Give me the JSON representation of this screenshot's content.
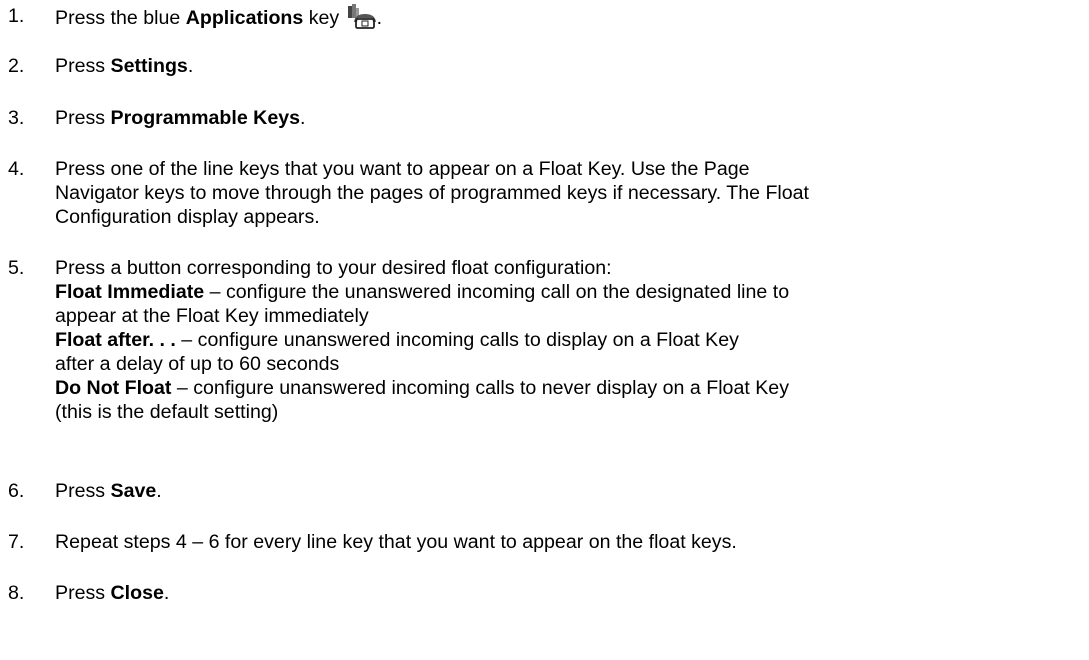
{
  "steps": [
    {
      "num": "1.",
      "parts": [
        {
          "t": "Press the blue "
        },
        {
          "t": "Applications",
          "b": true
        },
        {
          "t": " key "
        },
        {
          "icon": "applications-key-icon"
        },
        {
          "t": "."
        }
      ]
    },
    {
      "num": "2.",
      "parts": [
        {
          "t": "Press "
        },
        {
          "t": "Settings",
          "b": true
        },
        {
          "t": "."
        }
      ]
    },
    {
      "num": "3.",
      "parts": [
        {
          "t": "Press "
        },
        {
          "t": "Programmable Keys",
          "b": true
        },
        {
          "t": "."
        }
      ]
    },
    {
      "num": "4.",
      "lines": [
        [
          {
            "t": "Press one of the line keys that you want to appear on a Float Key. Use the Page"
          }
        ],
        [
          {
            "t": "Navigator keys to move through the pages of programmed keys if necessary. The Float"
          }
        ],
        [
          {
            "t": "Configuration display appears."
          }
        ]
      ]
    },
    {
      "num": "5.",
      "lines": [
        [
          {
            "t": "Press a button corresponding to your desired float configuration:"
          }
        ],
        [
          {
            "t": "Float Immediate",
            "b": true
          },
          {
            "t": " – configure the unanswered incoming call on the designated line to"
          }
        ],
        [
          {
            "t": "appear at the Float Key immediately"
          }
        ],
        [
          {
            "t": "Float after. . .",
            "b": true
          },
          {
            "t": " – configure unanswered incoming calls to display on a Float Key"
          }
        ],
        [
          {
            "t": "after a delay of up to 60 seconds"
          }
        ],
        [
          {
            "t": "Do Not Float",
            "b": true
          },
          {
            "t": " – configure unanswered incoming calls to never display on a Float Key"
          }
        ],
        [
          {
            "t": "(this is the default setting)"
          }
        ]
      ]
    },
    {
      "num": "6.",
      "parts": [
        {
          "t": "Press "
        },
        {
          "t": "Save",
          "b": true
        },
        {
          "t": "."
        }
      ]
    },
    {
      "num": "7.",
      "parts": [
        {
          "t": "Repeat steps 4 – 6 for every line key that you want to appear on the float keys."
        }
      ]
    },
    {
      "num": "8.",
      "parts": [
        {
          "t": "Press "
        },
        {
          "t": "Close",
          "b": true
        },
        {
          "t": "."
        }
      ]
    }
  ]
}
